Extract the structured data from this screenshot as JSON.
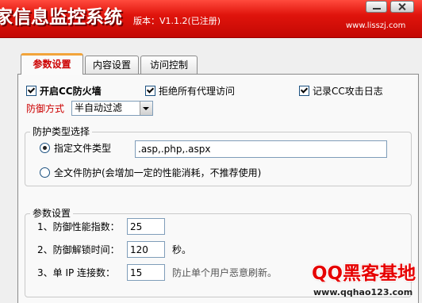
{
  "window": {
    "title": "家信息监控系统",
    "version": "版本：V1.1.2(已注册)",
    "website": "www.lisszj.com"
  },
  "icons": {
    "minimize": "minimize-icon",
    "close": "close-icon",
    "dropdown": "chevron-down-icon",
    "checkbox": "checkmark-icon",
    "radio": "radio-dot"
  },
  "tabs": [
    {
      "label": "参数设置",
      "selected": true
    },
    {
      "label": "内容设置",
      "selected": false
    },
    {
      "label": "访问控制",
      "selected": false
    }
  ],
  "options": {
    "enable_cc_firewall": {
      "label": "开启CC防火墙",
      "checked": true
    },
    "deny_all_proxies": {
      "label": "拒绝所有代理访问",
      "checked": true
    },
    "log_cc_attacks": {
      "label": "记录CC攻击日志",
      "checked": true
    }
  },
  "defense_mode": {
    "label": "防御方式",
    "value": "半自动过滤"
  },
  "protection_type": {
    "legend": "防护类型选择",
    "specified_files": {
      "label": "指定文件类型",
      "selected": true,
      "value": ".asp,.php,.aspx"
    },
    "all_files": {
      "label": "全文件防护(会增加一定的性能消耗，不推荐使用)",
      "selected": false
    }
  },
  "parameters": {
    "legend": "参数设置",
    "performance_index": {
      "label": "1、防御性能指数：",
      "value": "25"
    },
    "unlock_time": {
      "label": "2、防御解锁时间：",
      "value": "120",
      "suffix": "秒。"
    },
    "ip_connections": {
      "label": "3、单 IP 连接数：",
      "value": "15",
      "note": "防止单个用户恶意刷新。"
    }
  },
  "watermark": {
    "logo": "QQ黑客基地",
    "url": "www.qqhao123.com"
  },
  "colors": {
    "header_red": "#e0140c",
    "accent_red": "#cc0000",
    "watermark_red": "#e60000",
    "tab_highlight": "#f2a43a"
  }
}
